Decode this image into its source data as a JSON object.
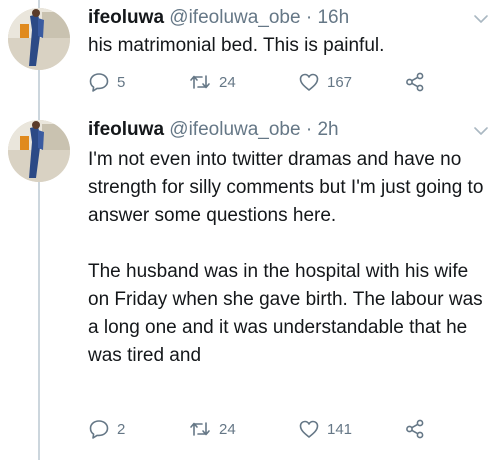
{
  "tweets": [
    {
      "display_name": "ifeoluwa",
      "handle": "@ifeoluwa_obe",
      "separator": "·",
      "time": "16h",
      "paragraphs": [
        "his matrimonial bed. This is painful."
      ],
      "replies": "5",
      "retweets": "24",
      "likes": "167"
    },
    {
      "display_name": "ifeoluwa",
      "handle": "@ifeoluwa_obe",
      "separator": "·",
      "time": "2h",
      "paragraphs": [
        "I'm not even into twitter dramas and have no strength for silly comments but I'm just going to answer some questions here.",
        "The husband was in the hospital with his wife on Friday when she gave birth. The labour was a long one and it was understandable that he was tired and"
      ],
      "replies": "2",
      "retweets": "24",
      "likes": "141"
    }
  ],
  "icons": {
    "reply": "reply-icon",
    "retweet": "retweet-icon",
    "like": "heart-icon",
    "share": "share-icon",
    "caret": "chevron-down-icon"
  },
  "colors": {
    "text": "#14171a",
    "meta": "#657786",
    "thread_line": "#ccd6dd"
  }
}
